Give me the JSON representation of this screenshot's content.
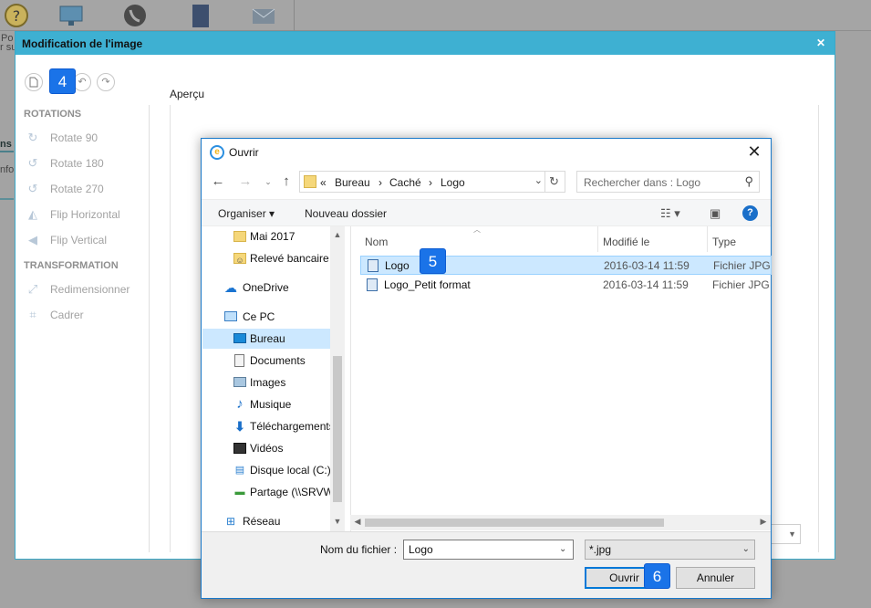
{
  "background": {
    "fragments": [
      "Po",
      "r su",
      "ns",
      "nfo"
    ]
  },
  "editor": {
    "title": "Modification de l'image",
    "close_icon": "close-icon",
    "badge_left": "4",
    "sections": {
      "rotations": "ROTATIONS",
      "transformation": "TRANSFORMATION"
    },
    "tools": {
      "rotate90": "Rotate 90",
      "rotate180": "Rotate 180",
      "rotate270": "Rotate 270",
      "flip_h": "Flip Horizontal",
      "flip_v": "Flip Vertical",
      "resize": "Redimensionner",
      "crop": "Cadrer"
    },
    "preview_label": "Aperçu"
  },
  "open_dialog": {
    "title": "Ouvrir",
    "address": {
      "prefix": "«",
      "segments": [
        "Bureau",
        "Caché",
        "Logo"
      ],
      "separator": "›"
    },
    "search_placeholder": "Rechercher dans : Logo",
    "command_bar": {
      "organize": "Organiser ▾",
      "new_folder": "Nouveau dossier"
    },
    "tree": [
      {
        "label": "Mai 2017",
        "icon": "folder-icon"
      },
      {
        "label": "Relevé bancaire",
        "icon": "folder-user-icon"
      },
      {
        "label": "OneDrive",
        "icon": "cloud-icon"
      },
      {
        "label": "Ce PC",
        "icon": "computer-icon"
      },
      {
        "label": "Bureau",
        "icon": "desktop-icon",
        "selected": true
      },
      {
        "label": "Documents",
        "icon": "documents-icon"
      },
      {
        "label": "Images",
        "icon": "images-icon"
      },
      {
        "label": "Musique",
        "icon": "music-icon"
      },
      {
        "label": "Téléchargements",
        "icon": "download-icon"
      },
      {
        "label": "Vidéos",
        "icon": "video-icon"
      },
      {
        "label": "Disque local (C:)",
        "icon": "drive-icon"
      },
      {
        "label": "Partage (\\\\SRVW",
        "icon": "network-drive-icon"
      },
      {
        "label": "Réseau",
        "icon": "network-icon"
      }
    ],
    "columns": {
      "name": "Nom",
      "modified": "Modifié le",
      "type": "Type"
    },
    "files": [
      {
        "name": "Logo",
        "modified": "2016-03-14 11:59",
        "type": "Fichier JPG",
        "selected": true
      },
      {
        "name": "Logo_Petit format",
        "modified": "2016-03-14 11:59",
        "type": "Fichier JPG",
        "selected": false
      }
    ],
    "badge_file": "5",
    "filename_label": "Nom du fichier :",
    "filename_value": "Logo",
    "filetype_value": "*.jpg",
    "open_button": "Ouvrir",
    "cancel_button": "Annuler",
    "badge_open": "6"
  },
  "colors": {
    "accent": "#3eb0d2",
    "selection": "#cce8ff",
    "badge": "#1a73e8"
  }
}
